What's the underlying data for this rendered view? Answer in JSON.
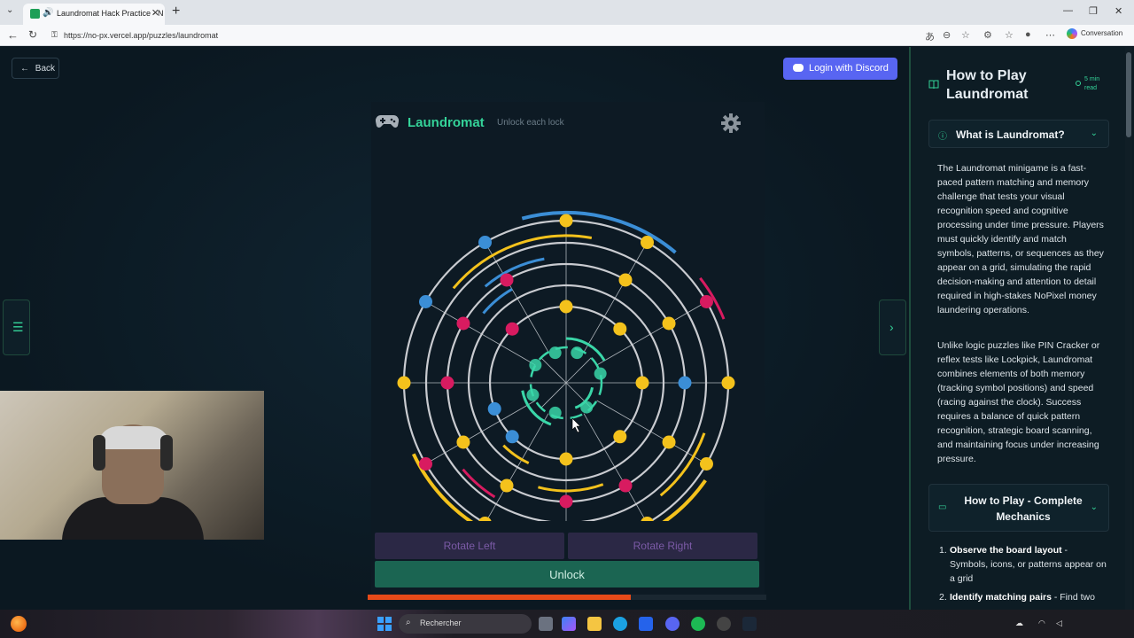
{
  "browser": {
    "tab_title": "Laundromat Hack Practice - N",
    "url": "https://no-px.vercel.app/puzzles/laundromat",
    "conversation_label": "Conversation"
  },
  "header": {
    "back_label": "Back",
    "discord_label": "Login with Discord"
  },
  "puzzle": {
    "title": "Laundromat",
    "subtitle": "Unlock each lock",
    "rotate_left": "Rotate Left",
    "rotate_right": "Rotate Right",
    "unlock": "Unlock",
    "timer_remaining_fraction": 0.66
  },
  "colors": {
    "accent": "#34d399",
    "yellow": "#f4c21c",
    "blue": "#3b8ed6",
    "pink": "#d81b60",
    "teal": "#3ad6a8",
    "ring": "#c9cbd0",
    "discord": "#5865f2",
    "timer": "#e64a19"
  },
  "guide": {
    "title": "How to Play Laundromat",
    "read_time": "5 min read",
    "section1_title": "What is Laundromat?",
    "para1": "The Laundromat minigame is a fast-paced pattern matching and memory challenge that tests your visual recognition speed and cognitive processing under time pressure. Players must quickly identify and match symbols, patterns, or sequences as they appear on a grid, simulating the rapid decision-making and attention to detail required in high-stakes NoPixel money laundering operations.",
    "para2": "Unlike logic puzzles like PIN Cracker or reflex tests like Lockpick, Laundromat combines elements of both memory (tracking symbol positions) and speed (racing against the clock). Success requires a balance of quick pattern recognition, strategic board scanning, and maintaining focus under increasing pressure.",
    "section2_title": "How to Play - Complete Mechanics",
    "steps": [
      {
        "num": "1.",
        "bold": "Observe the board layout",
        "text": " - Symbols, icons, or patterns appear on a grid"
      },
      {
        "num": "2.",
        "bold": "Identify matching pairs",
        "text": " - Find two"
      }
    ]
  },
  "taskbar": {
    "search_placeholder": "Rechercher"
  }
}
